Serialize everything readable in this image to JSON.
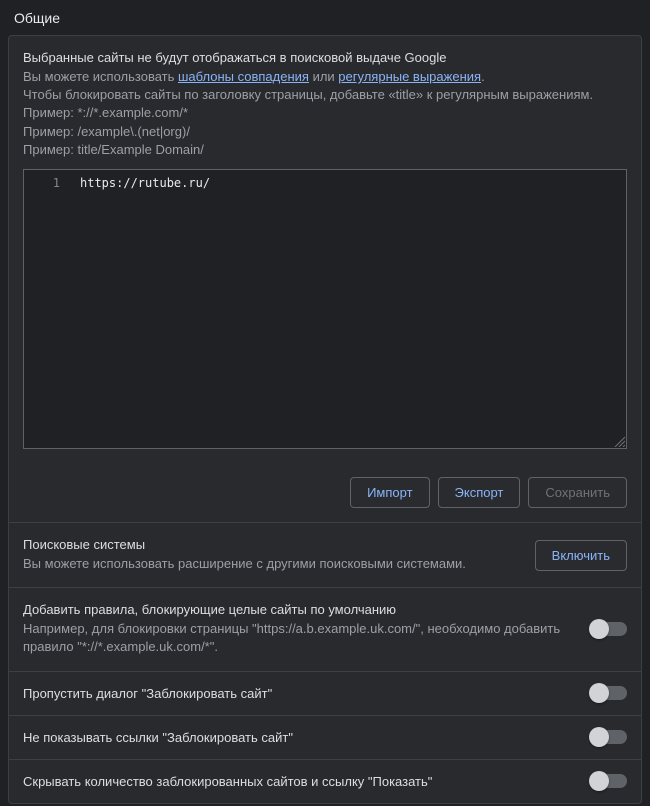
{
  "pageTitle": "Общие",
  "intro": {
    "header": "Выбранные сайты не будут отображаться в поисковой выдаче Google",
    "usePrefix": "Вы можете использовать ",
    "link1": "шаблоны совпадения",
    "mid": " или ",
    "link2": "регулярные выражения",
    "suffix": ".",
    "titleLine": "Чтобы блокировать сайты по заголовку страницы, добавьте «title» к регулярным выражениям.",
    "ex1": "Пример: *://*.example.com/*",
    "ex2": "Пример: /example\\.(net|org)/",
    "ex3": "Пример: title/Example Domain/"
  },
  "editor": {
    "lineNo": "1",
    "line1": "https://rutube.ru/"
  },
  "buttons": {
    "import": "Импорт",
    "export": "Экспорт",
    "save": "Сохранить",
    "enable": "Включить"
  },
  "rows": {
    "searchEngines": {
      "title": "Поисковые системы",
      "sub": "Вы можете использовать расширение с другими поисковыми системами."
    },
    "addRules": {
      "title": "Добавить правила, блокирующие целые сайты по умолчанию",
      "sub": "Например, для блокировки страницы \"https://a.b.example.uk.com/\", необходимо добавить правило \"*://*.example.uk.com/*\"."
    },
    "skipDialog": {
      "title": "Пропустить диалог \"Заблокировать сайт\""
    },
    "hideLinks": {
      "title": "Не показывать ссылки \"Заблокировать сайт\""
    },
    "hideCount": {
      "title": "Скрывать количество заблокированных сайтов и ссылку \"Показать\""
    }
  }
}
